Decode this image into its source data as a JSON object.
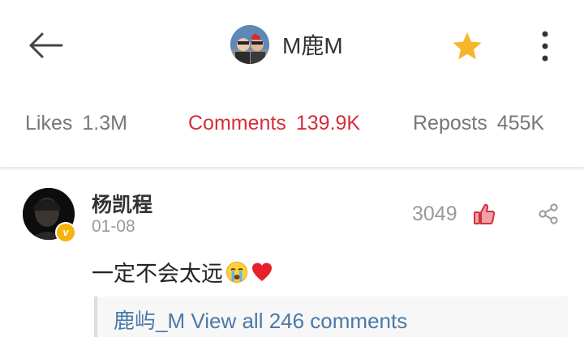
{
  "header": {
    "back_icon": "arrow-left-icon",
    "profile_name": "M鹿M",
    "favorite_icon": "star-icon",
    "favorite_color": "#f7b52c",
    "more_icon": "more-vertical-icon"
  },
  "tabs": [
    {
      "label": "Likes",
      "count": "1.3M",
      "active": false
    },
    {
      "label": "Comments",
      "count": "139.9K",
      "active": true
    },
    {
      "label": "Reposts",
      "count": "455K",
      "active": false
    }
  ],
  "accent_color": "#d32f3a",
  "comment": {
    "author": "杨凯程",
    "date": "01-08",
    "verified_badge": "v",
    "like_count": "3049",
    "like_icon": "thumbs-up-icon",
    "share_icon": "share-icon",
    "text": "一定不会太远",
    "emojis": [
      "crying-face-emoji",
      "red-heart-emoji"
    ],
    "replies": {
      "user": "鹿屿_M",
      "link_text": "View all 246 comments"
    }
  }
}
